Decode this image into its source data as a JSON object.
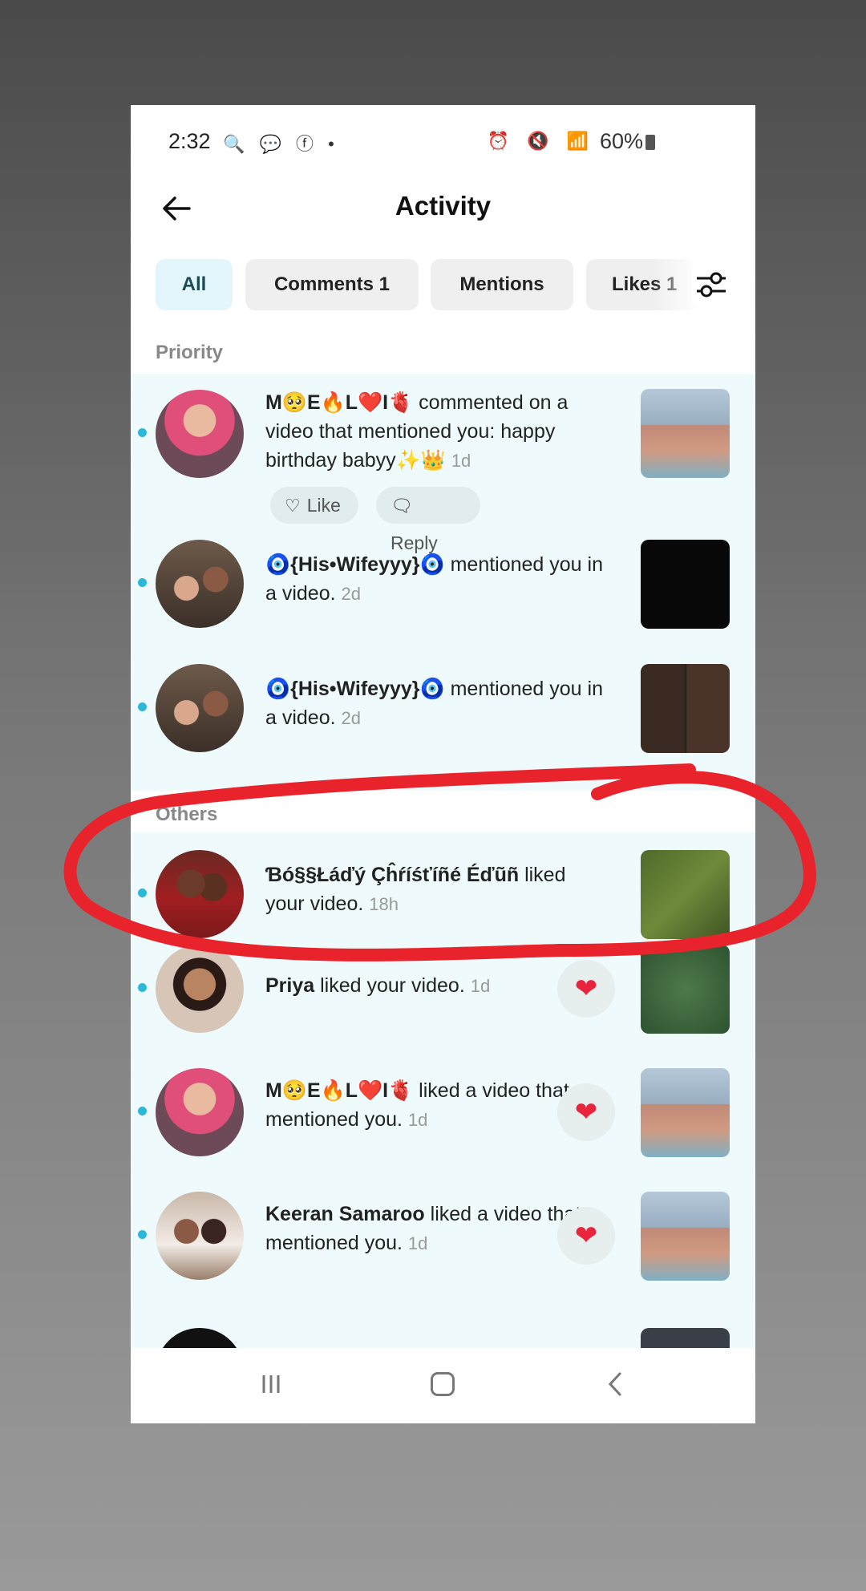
{
  "status": {
    "time": "2:32",
    "battery": "60%"
  },
  "header": {
    "title": "Activity"
  },
  "tabs": [
    {
      "label": "All"
    },
    {
      "label": "Comments 1"
    },
    {
      "label": "Mentions"
    },
    {
      "label": "Likes 1",
      "faded": "1"
    }
  ],
  "sections": {
    "priority": "Priority",
    "others": "Others"
  },
  "priority_items": [
    {
      "name": "M🥺E🔥L❤️I🫀",
      "action": " commented on a video that mentioned you: happy birthday babyy✨👑",
      "time": "1d",
      "like_label": "Like",
      "reply_label": "Reply"
    },
    {
      "name": "🧿{His•Wifeyyy}🧿",
      "action": " mentioned you in a video.",
      "time": "2d"
    },
    {
      "name": "🧿{His•Wifeyyy}🧿",
      "action": " mentioned you in a video.",
      "time": "2d"
    }
  ],
  "other_items": [
    {
      "name": "Ɓó§§Łáďý Çĥŕíśťíñé Éďũñ",
      "action": " liked your video.",
      "time": "18h"
    },
    {
      "name": "Priya",
      "action": " liked your video.",
      "time": "1d"
    },
    {
      "name": "M🥺E🔥L❤️I🫀",
      "action": " liked a video that mentioned you.",
      "time": "1d"
    },
    {
      "name": "Keeran Samaroo",
      "action": " liked a video that mentioned you.",
      "time": "1d"
    }
  ],
  "colors": {
    "accent_dot": "#2bb8d8",
    "highlight_bg": "#eefafc",
    "heart": "#e8253d",
    "annotation": "#e8232b"
  },
  "icons": [
    "back-arrow-icon",
    "filter-sliders-icon",
    "heart-icon",
    "reply-bubble-icon",
    "like-heart-outline-icon"
  ]
}
